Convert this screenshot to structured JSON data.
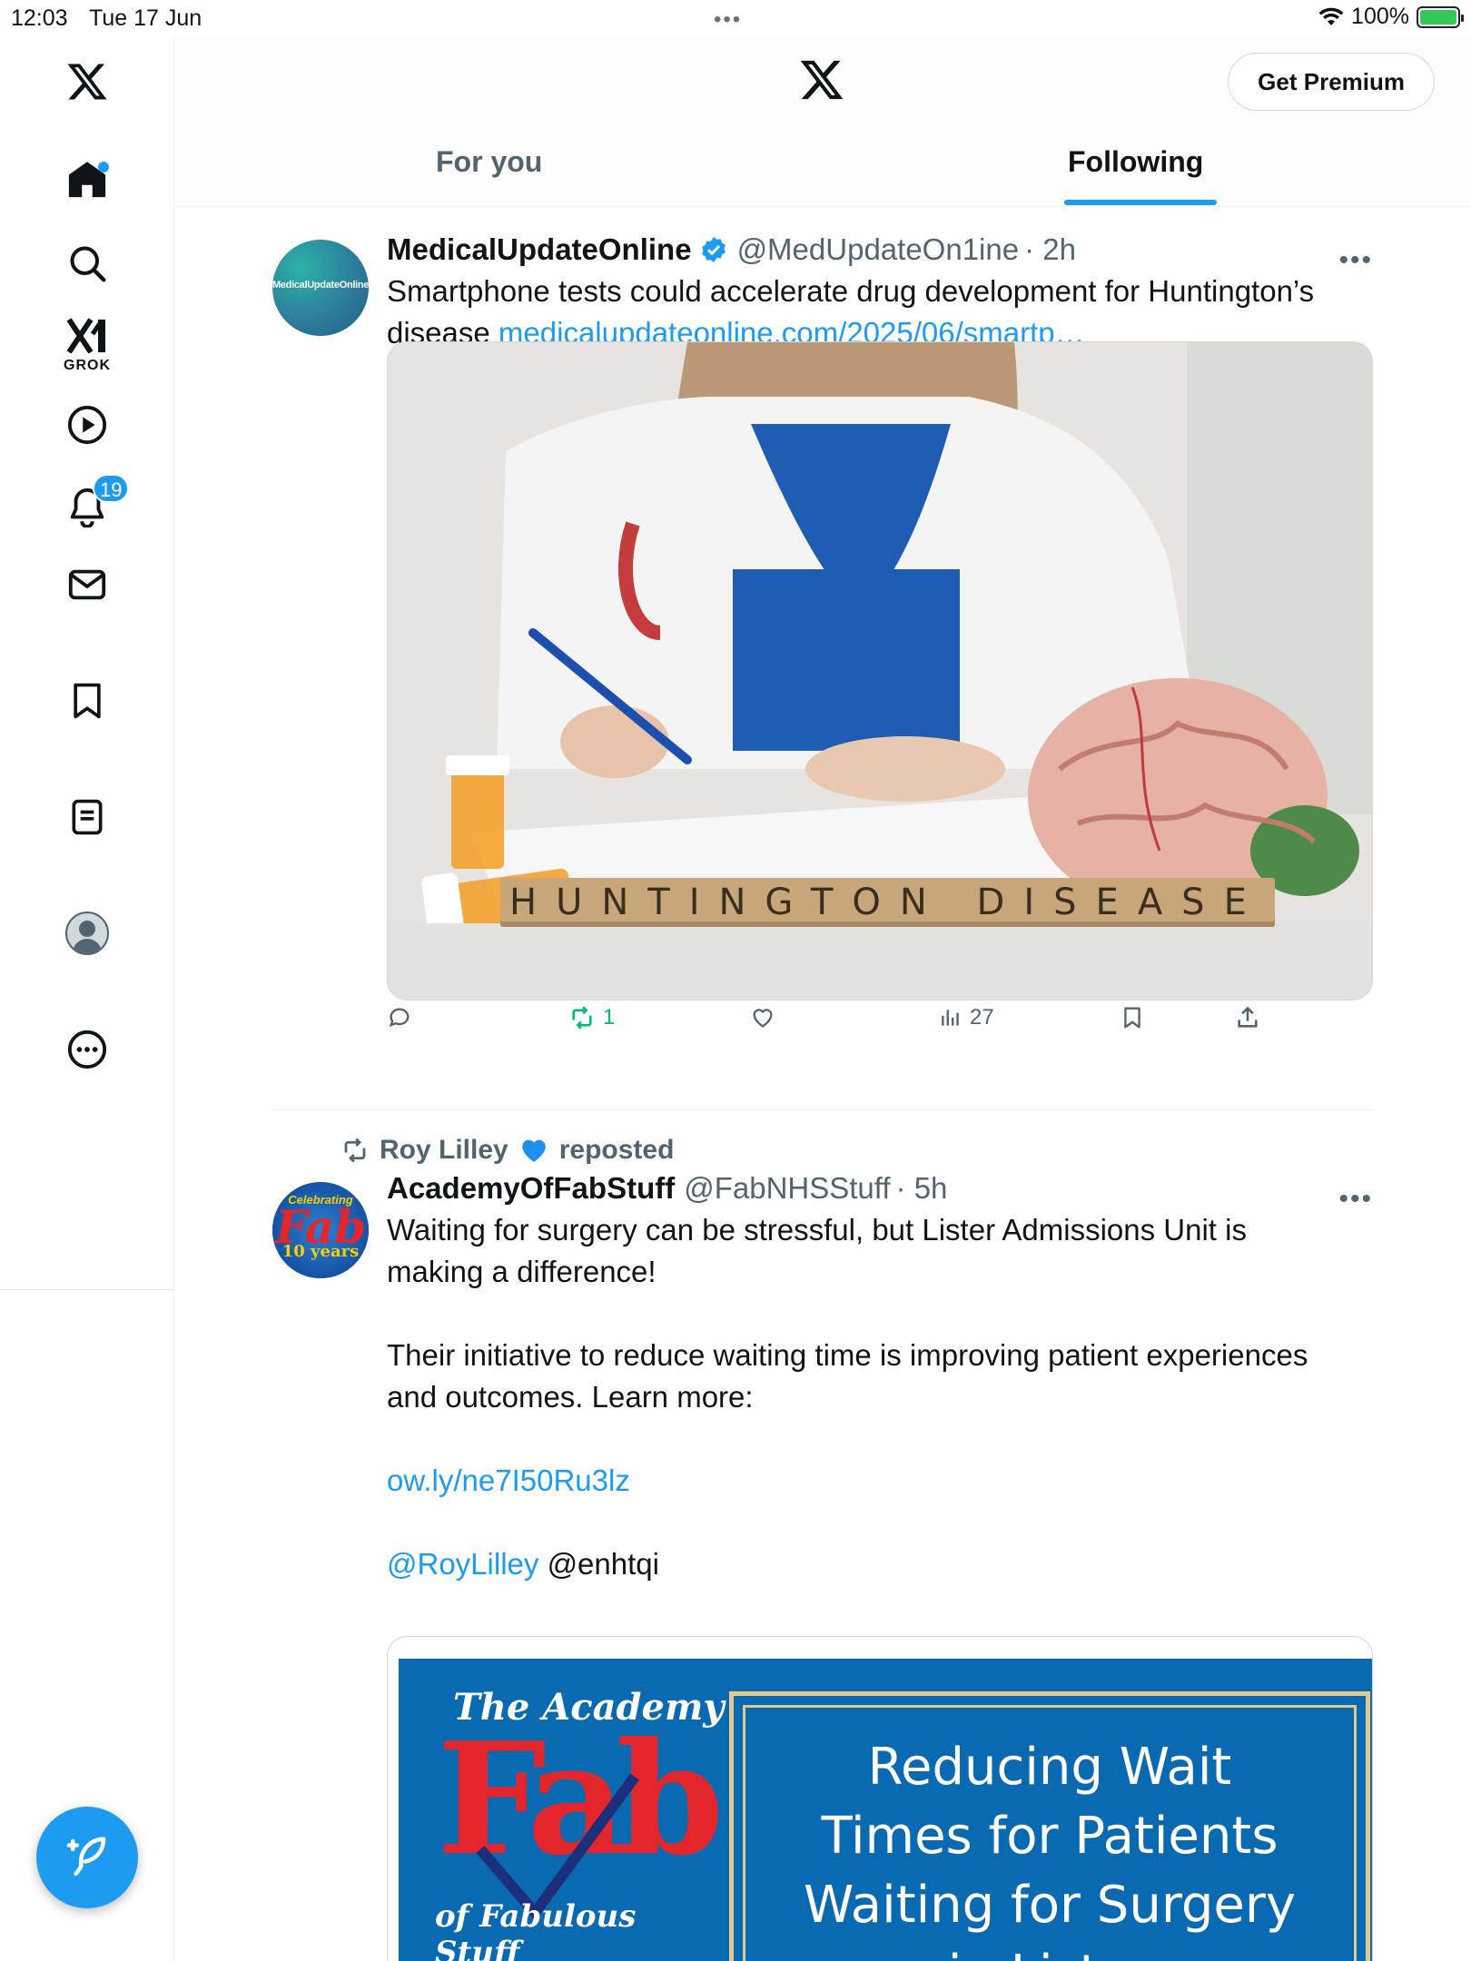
{
  "status_bar": {
    "time": "12:03",
    "date": "Tue 17 Jun",
    "battery": "100%"
  },
  "rail": {
    "grok_label": "GROK",
    "notifications_count": "19"
  },
  "header": {
    "premium_label": "Get Premium",
    "tabs": [
      {
        "label": "For you",
        "active": false
      },
      {
        "label": "Following",
        "active": true
      }
    ]
  },
  "tweets": [
    {
      "name": "MedicalUpdateOnline",
      "handle": "@MedUpdateOn1ine",
      "time": "· 2h",
      "text": "Smartphone tests could accelerate drug development for Huntington’s disease",
      "link": "medicalupdateonline.com/2025/06/smartp…",
      "avatar_text": "MedicalUpdateOnline",
      "image_caption": "HUNTINGTON DISEASE",
      "stats": {
        "reposts": "1",
        "views": "27"
      }
    },
    {
      "reposted_by": "Roy Lilley",
      "reposted_label": "reposted",
      "name": "AcademyOfFabStuff",
      "handle": "@FabNHSStuff",
      "time": "· 5h",
      "text_lines": [
        "Waiting for surgery can be stressful, but Lister Admissions Unit is",
        "making a difference!",
        "Their initiative to reduce waiting time is improving patient experiences",
        "and outcomes. Learn more:"
      ],
      "link": "ow.ly/ne7I50Ru3lz",
      "mention_link": "@RoyLilley",
      "mention_plain": "@enhtqi",
      "avatar_text": {
        "top": "Celebrating",
        "middle": "Fab",
        "bottom": "10 years"
      },
      "card": {
        "academy_top": "The Academy",
        "academy_fab": "Fab",
        "academy_bottom": "of Fabulous Stuff",
        "headline_lines": [
          "Reducing Wait",
          "Times for Patients",
          "Waiting for Surgery",
          "in Lister"
        ]
      }
    }
  ]
}
